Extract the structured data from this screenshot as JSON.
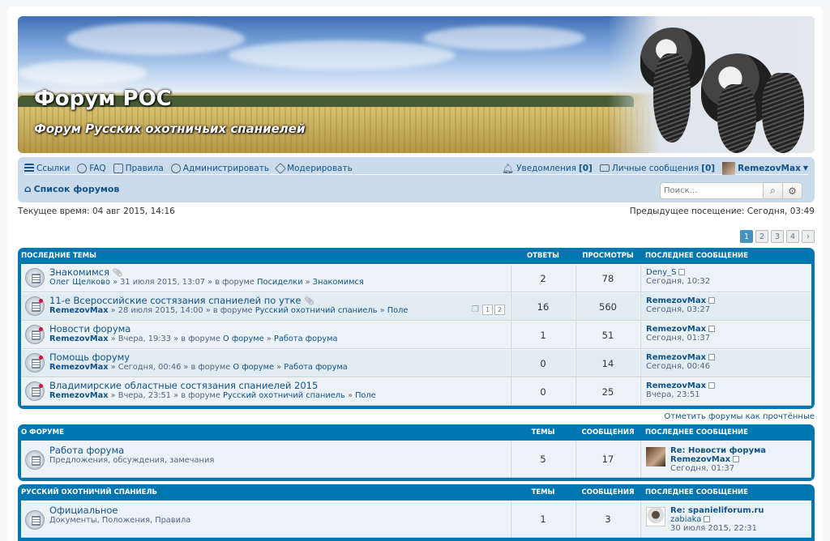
{
  "header": {
    "title": "Форум РОС",
    "description": "Форум Русских охотничьих спаниелей"
  },
  "nav": {
    "links": [
      {
        "label": "Ссылки",
        "icon": "menu-icon"
      },
      {
        "label": "FAQ",
        "icon": "help-icon"
      },
      {
        "label": "Правила",
        "icon": "rules-icon"
      },
      {
        "label": "Администрировать",
        "icon": "gears-icon"
      },
      {
        "label": "Модерировать",
        "icon": "gavel-icon"
      }
    ],
    "notifications_label": "Уведомления",
    "notifications_count": "[0]",
    "pm_label": "Личные сообщения",
    "pm_count": "[0]",
    "username": "RemezovMax",
    "breadcrumb": "Список форумов",
    "search_placeholder": "Поиск…"
  },
  "times": {
    "current": "Текущее время: 04 авг 2015, 14:16",
    "last_visit": "Предыдущее посещение: Сегодня, 03:49"
  },
  "pagination": [
    "1",
    "2",
    "3",
    "4",
    "›"
  ],
  "recent": {
    "headers": {
      "topic": "Последние темы",
      "replies": "Ответы",
      "views": "Просмотры",
      "last": "Последнее сообщение"
    },
    "rows": [
      {
        "title": "Знакомимся",
        "author": "Олег Щелково",
        "date": "» 31 июля 2015, 13:07 » в форуме",
        "forum": "Посиделки",
        "sub": "Знакомимся",
        "replies": "2",
        "views": "78",
        "lp_author": "Deny_S",
        "lp_time": "Сегодня, 10:32",
        "attach": true,
        "bold_author": false,
        "new": false
      },
      {
        "title": "11-е Всероссийские состязания спаниелей по утке",
        "author": "RemezovMax",
        "date": "» 28 июля 2015, 14:00 » в форуме",
        "forum": "Русский охотничий спаниель",
        "sub": "Поле",
        "replies": "16",
        "views": "560",
        "lp_author": "RemezovMax",
        "lp_time": "Сегодня, 03:27",
        "attach": true,
        "bold_author": true,
        "new": true,
        "pages": [
          "1",
          "2"
        ]
      },
      {
        "title": "Новости форума",
        "author": "RemezovMax",
        "date": "» Вчера, 19:33 » в форуме",
        "forum": "О форуме",
        "sub": "Работа форума",
        "replies": "1",
        "views": "51",
        "lp_author": "RemezovMax",
        "lp_time": "Сегодня, 01:37",
        "attach": false,
        "bold_author": true,
        "new": true
      },
      {
        "title": "Помощь форуму",
        "author": "RemezovMax",
        "date": "» Сегодня, 00:46 » в форуме",
        "forum": "О форуме",
        "sub": "Работа форума",
        "replies": "0",
        "views": "14",
        "lp_author": "RemezovMax",
        "lp_time": "Сегодня, 00:46",
        "attach": false,
        "bold_author": true,
        "new": true
      },
      {
        "title": "Владимирские областные состязания спаниелей 2015",
        "author": "RemezovMax",
        "date": "» Вчера, 23:51 » в форуме",
        "forum": "Русский охотничий спаниель",
        "sub": "Поле",
        "replies": "0",
        "views": "25",
        "lp_author": "RemezovMax",
        "lp_time": "Вчера, 23:51",
        "attach": false,
        "bold_author": true,
        "new": true
      }
    ]
  },
  "mark_read": "Отметить форумы как прочтённые",
  "cat1": {
    "headers": {
      "name": "О форуме",
      "topics": "Темы",
      "posts": "Сообщения",
      "last": "Последнее сообщение"
    },
    "row": {
      "title": "Работа форума",
      "desc": "Предложения, обсуждения, замечания",
      "topics": "5",
      "posts": "17",
      "lp_title": "Re: Новости форума",
      "lp_author": "RemezovMax",
      "lp_time": "Сегодня, 01:37"
    }
  },
  "cat2": {
    "headers": {
      "name": "Русский охотничий спаниель",
      "topics": "Темы",
      "posts": "Сообщения",
      "last": "Последнее сообщение"
    },
    "row": {
      "title": "Официальное",
      "desc": "Документы, Положения, Правила",
      "topics": "1",
      "posts": "3",
      "lp_title": "Re: spanieliforum.ru",
      "lp_author": "zabiaka",
      "lp_time": "30 июля 2015, 22:31"
    }
  }
}
